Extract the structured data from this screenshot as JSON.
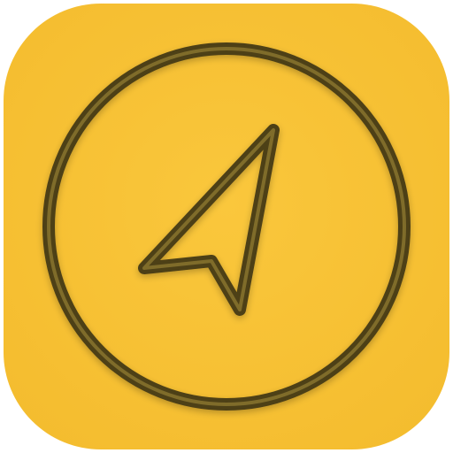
{
  "app_icon": {
    "name": "navigation-app-icon",
    "glyph": "navigation-arrow-icon",
    "enclosure": "circle-ring",
    "colors": {
      "tile_fill": "#FAC73C",
      "tile_edge": "#F4BC2E",
      "glyph_stroke": "#4E4018",
      "glyph_highlight": "#A08A3A"
    }
  }
}
